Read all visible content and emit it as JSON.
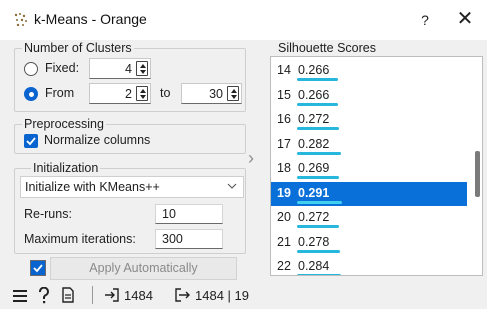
{
  "window": {
    "title": "k-Means - Orange",
    "help_label": "?",
    "close_label": "✕",
    "icon": "kmeans-dots-icon"
  },
  "clusters": {
    "title": "Number of Clusters",
    "fixed_label": "Fixed:",
    "fixed_value": "4",
    "from_label": "From",
    "from_value": "2",
    "to_label": "to",
    "to_value": "30",
    "selected_mode": "from"
  },
  "preprocessing": {
    "title": "Preprocessing",
    "normalize_label": "Normalize columns",
    "normalize_checked": true
  },
  "initialization": {
    "title": "Initialization",
    "method": "Initialize with KMeans++",
    "reruns_label": "Re-runs:",
    "reruns_value": "10",
    "maxiter_label": "Maximum iterations:",
    "maxiter_value": "300"
  },
  "apply": {
    "checked": true,
    "label": "Apply Automatically"
  },
  "silhouette": {
    "title": "Silhouette Scores",
    "selected_k": "19",
    "rows": [
      {
        "k": "14",
        "score": "0.266",
        "value": 0.266
      },
      {
        "k": "15",
        "score": "0.266",
        "value": 0.266
      },
      {
        "k": "16",
        "score": "0.272",
        "value": 0.272
      },
      {
        "k": "17",
        "score": "0.282",
        "value": 0.282
      },
      {
        "k": "18",
        "score": "0.269",
        "value": 0.269
      },
      {
        "k": "19",
        "score": "0.291",
        "value": 0.291
      },
      {
        "k": "20",
        "score": "0.272",
        "value": 0.272
      },
      {
        "k": "21",
        "score": "0.278",
        "value": 0.278
      },
      {
        "k": "22",
        "score": "0.284",
        "value": 0.284
      }
    ],
    "bar_color": "#27b7dc",
    "selection_color": "#0a70d9"
  },
  "statusbar": {
    "input_count": "1484",
    "output_count": "1484 | 19",
    "icons": [
      "menu-icon",
      "help-icon",
      "report-icon",
      "input-icon",
      "output-icon"
    ]
  }
}
